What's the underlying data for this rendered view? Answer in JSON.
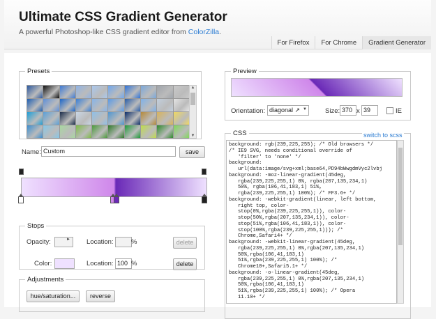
{
  "header": {
    "title": "Ultimate CSS Gradient Generator",
    "subtitle_prefix": "A powerful Photoshop-like CSS gradient editor from ",
    "subtitle_link": "ColorZilla",
    "subtitle_suffix": "."
  },
  "tabs": [
    {
      "label": "For Firefox"
    },
    {
      "label": "For Chrome"
    },
    {
      "label": "Gradient Generator"
    }
  ],
  "presets": {
    "legend": "Presets",
    "swatches": [
      "#2c5aa0",
      "#111111",
      "#3d7ad6",
      "#8fb3e6",
      "#a9c8ef",
      "#6fa7ef",
      "#2f73d8",
      "#7aa8dc",
      "#9fa4ab",
      "#c9c9c9",
      "#1e5fb3",
      "#5e8fd8",
      "#1b66c9",
      "#3a7fd6",
      "#86b4ea",
      "#5b9ae6",
      "#2a5ea8",
      "#7fb2ea",
      "#c2cfdd",
      "#e4e4e4",
      "#1e9fd8",
      "#5aa0d8",
      "#1b2d4a",
      "#c9d6e6",
      "#8ebfe8",
      "#5096d0",
      "#0d2f6a",
      "#b5893a",
      "#d8b35a",
      "#f0d860",
      "#3c8fd0",
      "#86c7e8",
      "#a8d8a0",
      "#7dbb48",
      "#4a9a3a",
      "#2f7a2a",
      "#1f9a3a",
      "#c0dc4a",
      "#2e8a2a",
      "#7fd85a"
    ]
  },
  "name": {
    "label": "Name:",
    "value": "Custom",
    "save_label": "save"
  },
  "gradient": {
    "stops": [
      {
        "color": "#efe1ff",
        "location": 0
      },
      {
        "color": "#cf87ea",
        "location": 50
      },
      {
        "color": "#6a29b7",
        "location": 51
      },
      {
        "color": "#efe1ff",
        "location": 100
      }
    ]
  },
  "stops_panel": {
    "legend": "Stops",
    "opacity_label": "Opacity:",
    "location_label": "Location:",
    "percent": "%",
    "delete_label": "delete",
    "color_label": "Color:",
    "color_value": "#efe1ff",
    "location_value": "100"
  },
  "adjustments": {
    "legend": "Adjustments",
    "hue_label": "hue/saturation...",
    "reverse_label": "reverse"
  },
  "preview": {
    "legend": "Preview",
    "orientation_label": "Orientation:",
    "orientation_value": "diagonal ↗",
    "size_label": "Size:",
    "width": "370",
    "x": "x",
    "height": "39",
    "ie_label": "IE"
  },
  "css": {
    "legend": "CSS",
    "switch_label": "switch to scss",
    "code": "background: rgb(239,225,255); /* Old browsers */\n/* IE9 SVG, needs conditional override of\n   'filter' to 'none' */\nbackground:\n   url(data:image/svg+xml;base64,PD94bWwgdmVyc2lvbj\nbackground: -moz-linear-gradient(45deg,\n   rgba(239,225,255,1) 0%, rgba(207,135,234,1)\n   50%, rgba(106,41,183,1) 51%,\n   rgba(239,225,255,1) 100%); /* FF3.6+ */\nbackground: -webkit-gradient(linear, left bottom,\n   right top, color-\n   stop(0%,rgba(239,225,255,1)), color-\n   stop(50%,rgba(207,135,234,1)), color-\n   stop(51%,rgba(106,41,183,1)), color-\n   stop(100%,rgba(239,225,255,1))); /*\n   Chrome,Safari4+ */\nbackground: -webkit-linear-gradient(45deg,\n   rgba(239,225,255,1) 0%,rgba(207,135,234,1)\n   50%,rgba(106,41,183,1)\n   51%,rgba(239,225,255,1) 100%); /*\n   Chrome10+,Safari5.1+ */\nbackground: -o-linear-gradient(45deg,\n   rgba(239,225,255,1) 0%,rgba(207,135,234,1)\n   50%,rgba(106,41,183,1)\n   51%,rgba(239,225,255,1) 100%); /* Opera\n   11.10+ */"
  }
}
